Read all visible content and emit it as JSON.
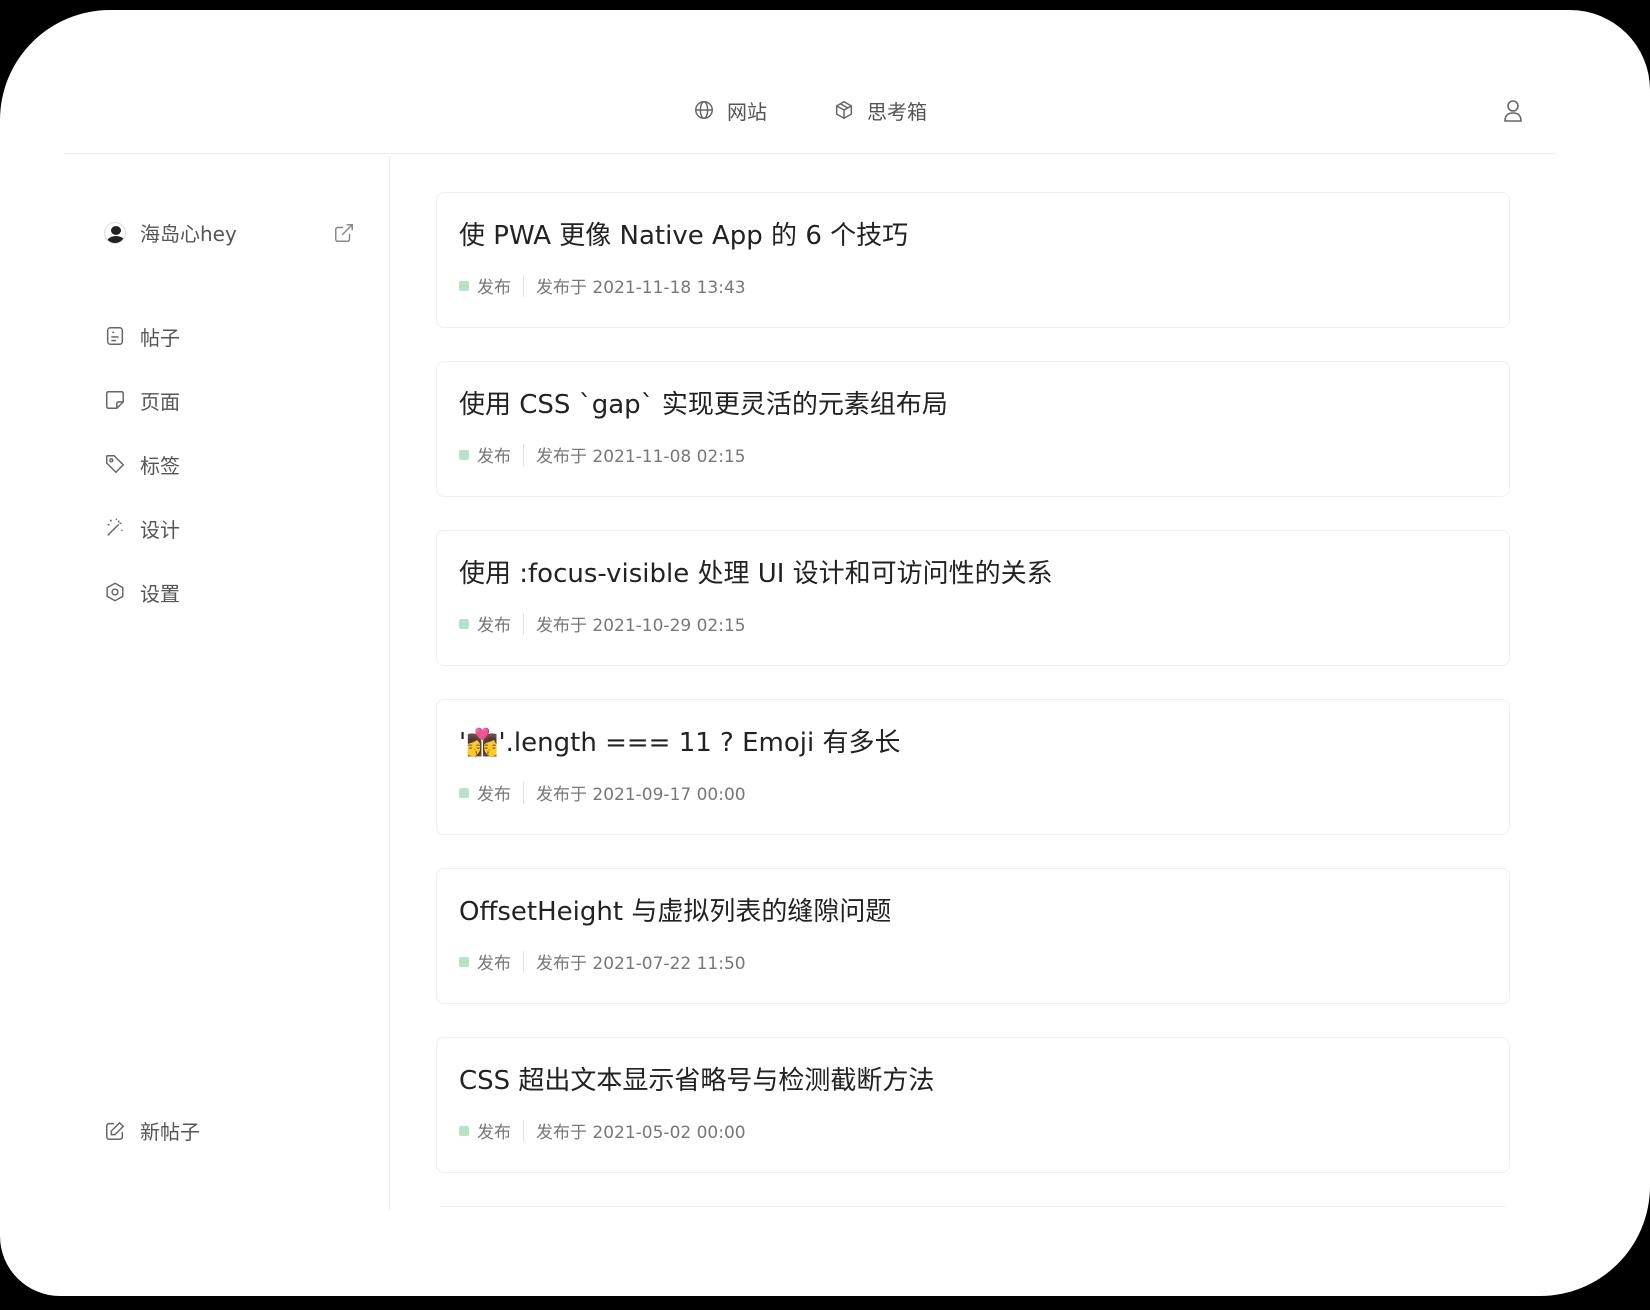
{
  "topnav": {
    "items": [
      {
        "label": "网站",
        "icon": "globe-icon"
      },
      {
        "label": "思考箱",
        "icon": "box-icon"
      }
    ],
    "user_icon": "user-icon"
  },
  "sidebar": {
    "profile": {
      "name": "海岛心hey",
      "external_icon": "external-link-icon"
    },
    "menu": [
      {
        "label": "帖子",
        "icon": "post-icon"
      },
      {
        "label": "页面",
        "icon": "page-icon"
      },
      {
        "label": "标签",
        "icon": "tag-icon"
      },
      {
        "label": "设计",
        "icon": "magic-wand-icon"
      },
      {
        "label": "设置",
        "icon": "settings-icon"
      }
    ],
    "new_post": {
      "label": "新帖子",
      "icon": "edit-icon"
    }
  },
  "posts": [
    {
      "title": "使 PWA 更像 Native App 的 6 个技巧",
      "status": "发布",
      "date": "发布于 2021-11-18 13:43"
    },
    {
      "title": "使用 CSS `gap` 实现更灵活的元素组布局",
      "status": "发布",
      "date": "发布于 2021-11-08 02:15"
    },
    {
      "title": "使用 :focus-visible 处理 UI 设计和可访问性的关系",
      "status": "发布",
      "date": "发布于 2021-10-29 02:15"
    },
    {
      "title": "'👩‍❤️‍💋‍👩'.length === 11 ? Emoji 有多长",
      "status": "发布",
      "date": "发布于 2021-09-17 00:00"
    },
    {
      "title": "OffsetHeight 与虚拟列表的缝隙问题",
      "status": "发布",
      "date": "发布于 2021-07-22 11:50"
    },
    {
      "title": "CSS 超出文本显示省略号与检测截断方法",
      "status": "发布",
      "date": "发布于 2021-05-02 00:00"
    }
  ],
  "colors": {
    "status_published": "#b9e2cb",
    "text": "#222222",
    "muted": "#777777",
    "border": "#ececec"
  }
}
